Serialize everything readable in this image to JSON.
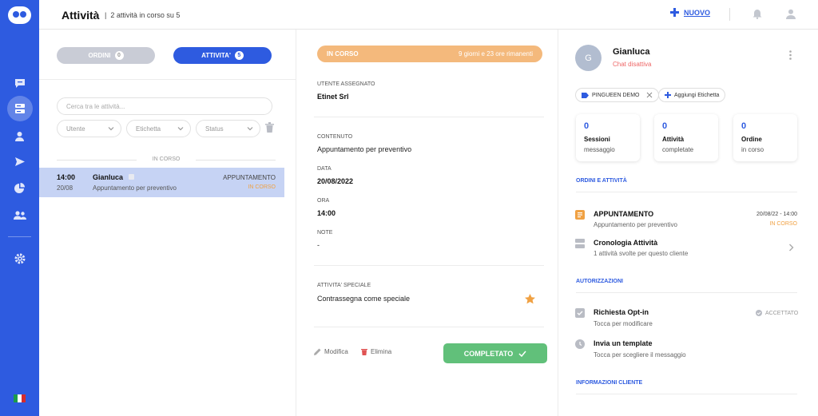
{
  "header": {
    "title": "Attività",
    "separator": "|",
    "subtitle": "2 attività in corso su 5",
    "new_label": "NUOVO"
  },
  "sidebar": {
    "items": [
      {
        "icon": "chat-icon"
      },
      {
        "icon": "activities-icon",
        "active": true
      },
      {
        "icon": "contacts-icon"
      },
      {
        "icon": "send-icon"
      },
      {
        "icon": "stats-icon"
      },
      {
        "icon": "team-icon"
      },
      {
        "icon": "settings-icon"
      }
    ],
    "flag": "italy-flag-icon"
  },
  "list": {
    "toggle_orders": {
      "label": "ORDINI",
      "count": "0"
    },
    "toggle_activities": {
      "label": "ATTIVITA'",
      "count": "5"
    },
    "search_placeholder": "Cerca tra le attività...",
    "filters": [
      "Utente",
      "Etichetta",
      "Status"
    ],
    "section": "IN CORSO",
    "items": [
      {
        "time": "14:00",
        "date": "20/08",
        "name": "Gianluca",
        "desc": "Appuntamento per preventivo",
        "type": "APPUNTAMENTO",
        "status": "IN CORSO"
      }
    ]
  },
  "detail": {
    "banner_status": "IN CORSO",
    "banner_remaining": "9 giorni e 23 ore rimanenti",
    "assigned_label": "UTENTE ASSEGNATO",
    "assigned_value": "Etinet Srl",
    "content_label": "CONTENUTO",
    "content_value": "Appuntamento per preventivo",
    "date_label": "DATA",
    "date_value": "20/08/2022",
    "time_label": "ORA",
    "time_value": "14:00",
    "notes_label": "NOTE",
    "notes_value": "-",
    "special_label": "ATTIVITA' SPECIALE",
    "special_value": "Contrassegna come speciale",
    "edit_label": "Modifica",
    "delete_label": "Elimina",
    "complete_label": "COMPLETATO"
  },
  "customer": {
    "initial": "G",
    "name": "Gianluca",
    "chat_status": "Chat disattiva",
    "tag": "PINGUEEN DEMO",
    "add_tag": "Aggiungi Etichetta",
    "stats": [
      {
        "value": "0",
        "label1": "Sessioni",
        "label2": "messaggio"
      },
      {
        "value": "0",
        "label1": "Attività",
        "label2": "completate"
      },
      {
        "value": "0",
        "label1": "Ordine",
        "label2": "in corso"
      }
    ],
    "orders_title": "ORDINI E ATTIVITÀ",
    "appointment": {
      "title": "APPUNTAMENTO",
      "sub": "Appuntamento per preventivo",
      "when": "20/08/22 - 14:00",
      "status": "IN CORSO"
    },
    "history": {
      "title": "Cronologia Attività",
      "sub": "1 attività svolte per questo cliente"
    },
    "auth_title": "AUTORIZZAZIONI",
    "optin": {
      "title": "Richiesta Opt-in",
      "sub": "Tocca per modificare",
      "status": "ACCETTATO"
    },
    "template": {
      "title": "Invia un template",
      "sub": "Tocca per scegliere il messaggio"
    },
    "info_title": "INFORMAZIONI CLIENTE"
  },
  "colors": {
    "primary": "#2e5be0",
    "in_progress": "#f4b97c",
    "success": "#61c07a",
    "selected_row": "#c6d3f4"
  }
}
